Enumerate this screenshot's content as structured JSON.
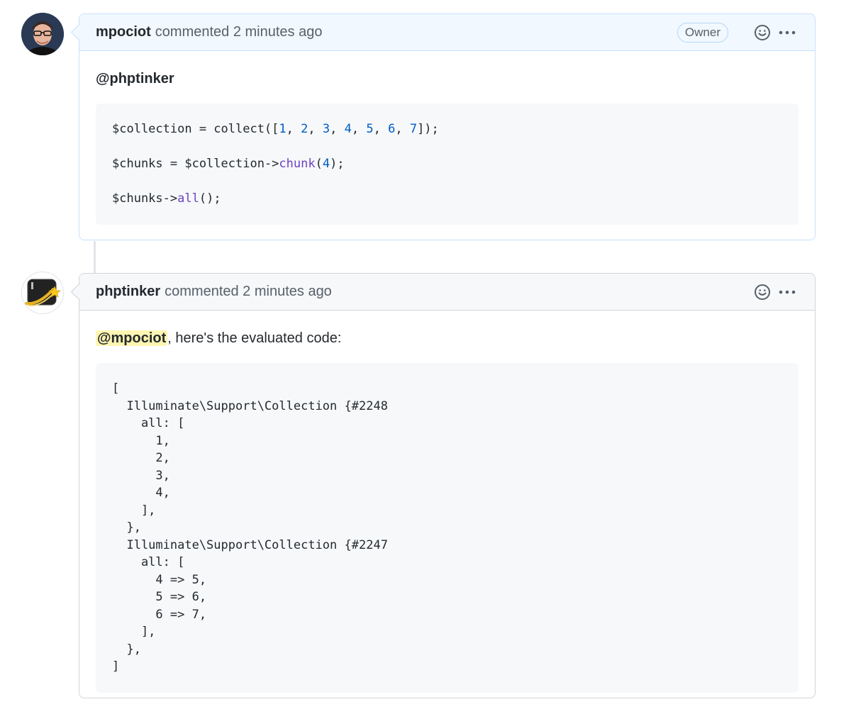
{
  "comments": [
    {
      "author": "mpociot",
      "meta": "commented 2 minutes ago",
      "badge": "Owner",
      "mention": "@phptinker",
      "code_lines": [
        [
          {
            "t": "$collection = collect([",
            "c": "plain"
          },
          {
            "t": "1",
            "c": "num"
          },
          {
            "t": ", ",
            "c": "plain"
          },
          {
            "t": "2",
            "c": "num"
          },
          {
            "t": ", ",
            "c": "plain"
          },
          {
            "t": "3",
            "c": "num"
          },
          {
            "t": ", ",
            "c": "plain"
          },
          {
            "t": "4",
            "c": "num"
          },
          {
            "t": ", ",
            "c": "plain"
          },
          {
            "t": "5",
            "c": "num"
          },
          {
            "t": ", ",
            "c": "plain"
          },
          {
            "t": "6",
            "c": "num"
          },
          {
            "t": ", ",
            "c": "plain"
          },
          {
            "t": "7",
            "c": "num"
          },
          {
            "t": "]);",
            "c": "plain"
          }
        ],
        [],
        [
          {
            "t": "$chunks = $collection->",
            "c": "plain"
          },
          {
            "t": "chunk",
            "c": "fn"
          },
          {
            "t": "(",
            "c": "plain"
          },
          {
            "t": "4",
            "c": "num"
          },
          {
            "t": ");",
            "c": "plain"
          }
        ],
        [],
        [
          {
            "t": "$chunks->",
            "c": "plain"
          },
          {
            "t": "all",
            "c": "fn"
          },
          {
            "t": "();",
            "c": "plain"
          }
        ]
      ]
    },
    {
      "author": "phptinker",
      "meta": "commented 2 minutes ago",
      "mention": "@mpociot",
      "text_after_mention": ", here's the evaluated code:",
      "code_lines": [
        [
          {
            "t": "[",
            "c": "plain"
          }
        ],
        [
          {
            "t": "  Illuminate\\Support\\Collection {#2248",
            "c": "plain"
          }
        ],
        [
          {
            "t": "    all: [",
            "c": "plain"
          }
        ],
        [
          {
            "t": "      1,",
            "c": "plain"
          }
        ],
        [
          {
            "t": "      2,",
            "c": "plain"
          }
        ],
        [
          {
            "t": "      3,",
            "c": "plain"
          }
        ],
        [
          {
            "t": "      4,",
            "c": "plain"
          }
        ],
        [
          {
            "t": "    ],",
            "c": "plain"
          }
        ],
        [
          {
            "t": "  },",
            "c": "plain"
          }
        ],
        [
          {
            "t": "  Illuminate\\Support\\Collection {#2247",
            "c": "plain"
          }
        ],
        [
          {
            "t": "    all: [",
            "c": "plain"
          }
        ],
        [
          {
            "t": "      4 => 5,",
            "c": "plain"
          }
        ],
        [
          {
            "t": "      5 => 6,",
            "c": "plain"
          }
        ],
        [
          {
            "t": "      6 => 7,",
            "c": "plain"
          }
        ],
        [
          {
            "t": "    ],",
            "c": "plain"
          }
        ],
        [
          {
            "t": "  },",
            "c": "plain"
          }
        ],
        [
          {
            "t": "]",
            "c": "plain"
          }
        ]
      ]
    }
  ],
  "icons": {
    "reaction": "smiley-icon",
    "more": "kebab-horizontal-icon"
  },
  "colors": {
    "owner_header_bg": "#f1f8ff",
    "owner_border": "#c8e1ff",
    "mention_highlight": "#fff5b1",
    "code_number": "#005cc5",
    "code_function": "#6f42c1"
  }
}
